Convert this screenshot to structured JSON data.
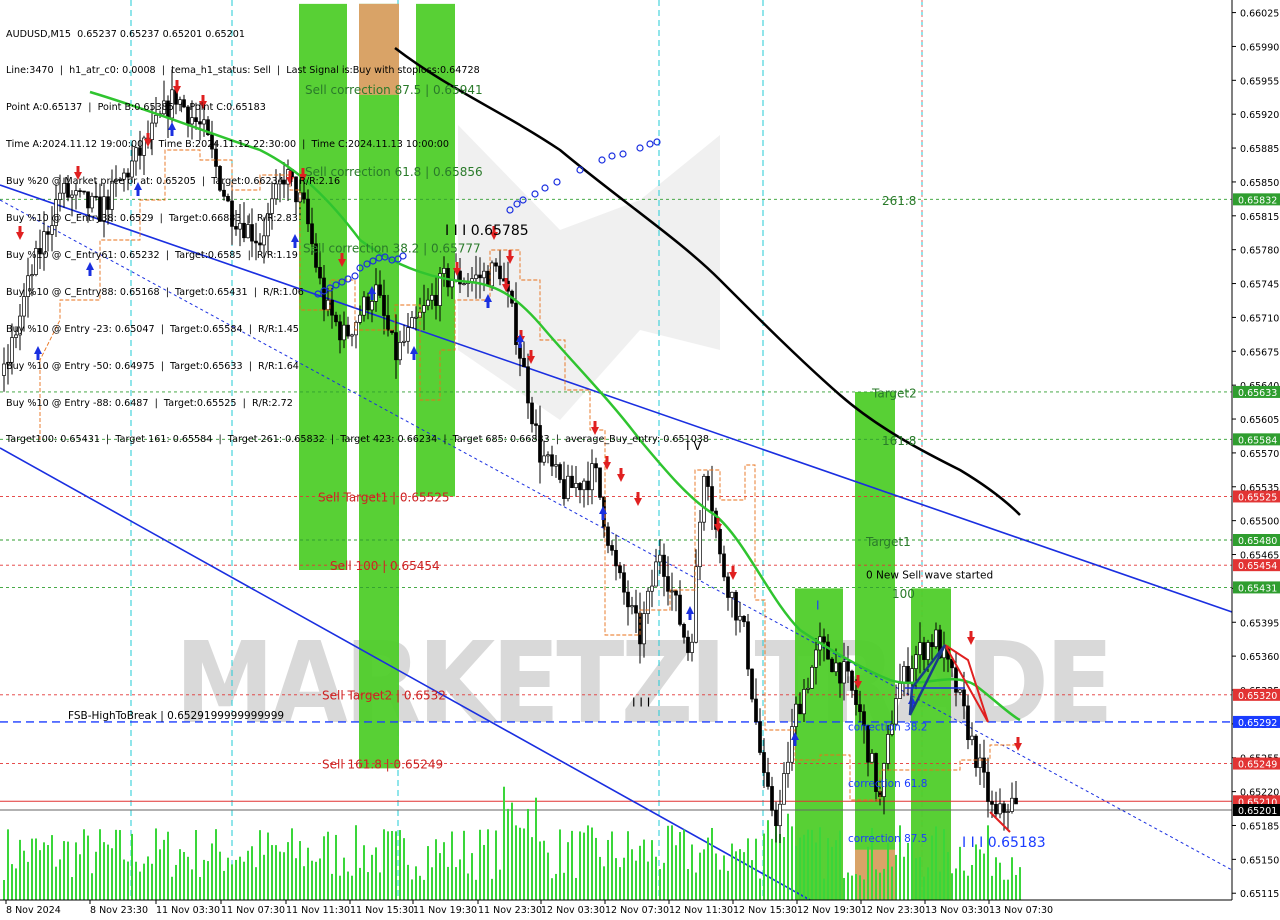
{
  "window": {
    "symbol_timeframe": "AUDUSD,M15",
    "ohlc": "0.65237 0.65237 0.65201 0.65201"
  },
  "info_lines": [
    "Line:3470  |  h1_atr_c0: 0.0008  |  tema_h1_status: Sell  |  Last Signal is:Buy with stoploss:0.64728",
    "Point A:0.65137  |  Point B:0.65385  |  Point C:0.65183",
    "Time A:2024.11.12 19:00:00  |  Time B:2024.11.12 22:30:00  |  Time C:2024.11.13 10:00:00",
    "Buy %20 @ Market price or at: 0.65205  |  Target:0.66234  |  R/R:2.16",
    "Buy %10 @ C_Entry38: 0.6529  |  Target:0.66883  |  R/R:2.83",
    "Buy %10 @ C_Entry61: 0.65232  |  Target:0.6585  |  R/R:1.19",
    "Buy %10 @ C_Entry88: 0.65168  |  Target:0.65431  |  R/R:1.06",
    "Buy %10 @ Entry -23: 0.65047  |  Target:0.65584  |  R/R:1.45",
    "Buy %10 @ Entry -50: 0.64975  |  Target:0.65633  |  R/R:1.64",
    "Buy %10 @ Entry -88: 0.6487  |  Target:0.65525  |  R/R:2.72",
    "Target100: 0.65431  |  Target 161: 0.65584  |  Target 261: 0.65832  |  Target 423: 0.66234  |  Target 685: 0.66883  |  average_Buy_entry: 0.651038"
  ],
  "chart_data": {
    "type": "candlestick",
    "symbol": "AUDUSD",
    "timeframe": "M15",
    "y_range": [
      0.65105,
      0.6603
    ],
    "y_ticks": [
      "0.66025",
      "0.65990",
      "0.65955",
      "0.65920",
      "0.65885",
      "0.65850",
      "0.65815",
      "0.65780",
      "0.65745",
      "0.65710",
      "0.65675",
      "0.65640",
      "0.65605",
      "0.65570",
      "0.65535",
      "0.65500",
      "0.65465",
      "0.65430",
      "0.65395",
      "0.65360",
      "0.65325",
      "0.65290",
      "0.65255",
      "0.65220",
      "0.65185",
      "0.65150",
      "0.65115"
    ],
    "x_ticks": [
      {
        "label": "8 Nov 2024",
        "x": 0
      },
      {
        "label": "8 Nov 23:30",
        "x": 1
      },
      {
        "label": "11 Nov 03:30",
        "x": 2
      },
      {
        "label": "11 Nov 07:30",
        "x": 3
      },
      {
        "label": "11 Nov 11:30",
        "x": 4
      },
      {
        "label": "11 Nov 15:30",
        "x": 5
      },
      {
        "label": "11 Nov 19:30",
        "x": 6
      },
      {
        "label": "11 Nov 23:30",
        "x": 7
      },
      {
        "label": "12 Nov 03:30",
        "x": 8
      },
      {
        "label": "12 Nov 07:30",
        "x": 9
      },
      {
        "label": "12 Nov 11:30",
        "x": 10
      },
      {
        "label": "12 Nov 15:30",
        "x": 11
      },
      {
        "label": "12 Nov 19:30",
        "x": 12
      },
      {
        "label": "12 Nov 23:30",
        "x": 13
      },
      {
        "label": "13 Nov 03:30",
        "x": 14
      },
      {
        "label": "13 Nov 07:30",
        "x": 15
      }
    ],
    "price_marks": [
      {
        "value": "0.65832",
        "price": 0.65832,
        "color": "#2f9e2f"
      },
      {
        "value": "0.65633",
        "price": 0.65633,
        "color": "#2f9e2f"
      },
      {
        "value": "0.65584",
        "price": 0.65584,
        "color": "#2f9e2f"
      },
      {
        "value": "0.65525",
        "price": 0.65525,
        "color": "#e23434"
      },
      {
        "value": "0.65480",
        "price": 0.6548,
        "color": "#2f9e2f"
      },
      {
        "value": "0.65454",
        "price": 0.65454,
        "color": "#e23434"
      },
      {
        "value": "0.65431",
        "price": 0.65431,
        "color": "#2f9e2f"
      },
      {
        "value": "0.65320",
        "price": 0.6532,
        "color": "#e23434"
      },
      {
        "value": "0.65292",
        "price": 0.65292,
        "color": "#1a3cff"
      },
      {
        "value": "0.65249",
        "price": 0.65249,
        "color": "#e23434"
      },
      {
        "value": "0.65210",
        "price": 0.6521,
        "color": "#e23434"
      },
      {
        "value": "0.65201",
        "price": 0.65201,
        "color": "#000000"
      }
    ],
    "level_labels": [
      {
        "text": "Sell correction 87.5 | 0.65941",
        "price": 0.65941,
        "color": "#2a7a2a"
      },
      {
        "text": "Sell correction 61.8 | 0.65856",
        "price": 0.65856,
        "color": "#2a7a2a"
      },
      {
        "text": "Sell correction 38.2 | 0.65777",
        "price": 0.65777,
        "color": "#2a7a2a"
      },
      {
        "text": "I I I 0.65785",
        "price": 0.65795,
        "color": "#000000"
      },
      {
        "text": "261.8",
        "price": 0.65826,
        "color": "#2a7a2a"
      },
      {
        "text": "Target2",
        "price": 0.65627,
        "color": "#2a7a2a"
      },
      {
        "text": "161.8",
        "price": 0.65578,
        "color": "#2a7a2a"
      },
      {
        "text": "Sell Target1 | 0.65525",
        "price": 0.6552,
        "color": "#cc2222"
      },
      {
        "text": "Target1",
        "price": 0.65474,
        "color": "#2a7a2a"
      },
      {
        "text": "Sell 100 | 0.65454",
        "price": 0.65449,
        "color": "#cc2222"
      },
      {
        "text": "0 New Sell wave started",
        "price": 0.6544,
        "color": "#000000"
      },
      {
        "text": "100",
        "price": 0.6542,
        "color": "#2a7a2a"
      },
      {
        "text": "Sell Target2 | 0.6532",
        "price": 0.65315,
        "color": "#cc2222"
      },
      {
        "text": "FSB-HighToBreak | 0.6529199999999999",
        "price": 0.65295,
        "color": "#000000"
      },
      {
        "text": "correction 38.2",
        "price": 0.65283,
        "color": "#1a3cff"
      },
      {
        "text": "Sell 161.8 | 0.65249",
        "price": 0.65244,
        "color": "#cc2222"
      },
      {
        "text": "correction 61.8",
        "price": 0.65225,
        "color": "#1a3cff"
      },
      {
        "text": "correction 87.5",
        "price": 0.65168,
        "color": "#1a3cff"
      },
      {
        "text": "I I I 0.65183",
        "price": 0.65163,
        "color": "#1a3cff"
      },
      {
        "text": "I V",
        "price": 0.65573,
        "color": "#000000"
      },
      {
        "text": "I I I",
        "price": 0.65308,
        "color": "#000000"
      },
      {
        "text": "I",
        "price": 0.65408,
        "color": "#1a3cff"
      }
    ],
    "watermark": "MARKETZI TRADE"
  }
}
